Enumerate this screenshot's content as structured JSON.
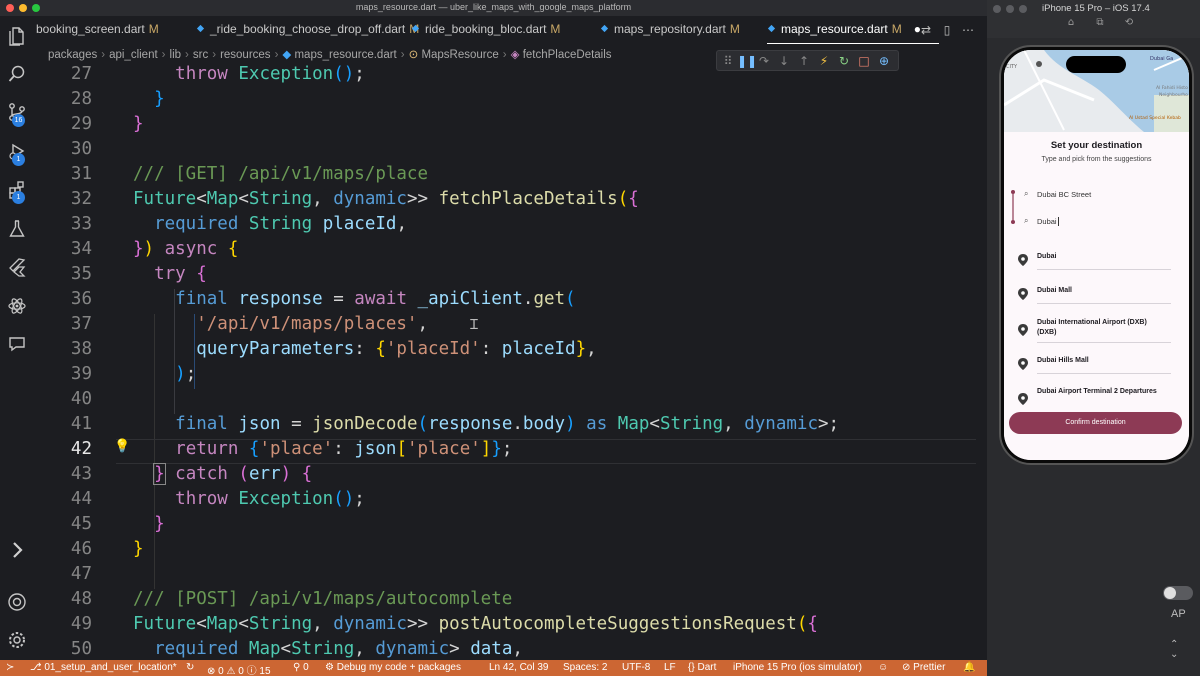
{
  "window": {
    "title": "maps_resource.dart — uber_like_maps_with_google_maps_platform"
  },
  "activity": {
    "badges": {
      "scm": "16",
      "run": "1",
      "extensions": "1"
    }
  },
  "tabs": [
    {
      "label": "booking_screen.dart",
      "status": "M"
    },
    {
      "label": "_ride_booking_choose_drop_off.dart",
      "status": "M"
    },
    {
      "label": "ride_booking_bloc.dart",
      "status": "M"
    },
    {
      "label": "maps_repository.dart",
      "status": "M"
    },
    {
      "label": "maps_resource.dart",
      "status": "M"
    }
  ],
  "breadcrumb": [
    "packages",
    "api_client",
    "lib",
    "src",
    "resources",
    "maps_resource.dart",
    "MapsResource",
    "fetchPlaceDetails"
  ],
  "editor": {
    "line_numbers": [
      "27",
      "28",
      "29",
      "30",
      "31",
      "32",
      "33",
      "34",
      "35",
      "36",
      "37",
      "38",
      "39",
      "40",
      "41",
      "42",
      "43",
      "44",
      "45",
      "46",
      "47",
      "48",
      "49",
      "50"
    ],
    "current_line": "42",
    "code": {
      "get_comment": "/// [GET] /api/v1/maps/place",
      "post_comment": "/// [POST] /api/v1/maps/autocomplete",
      "fn1_name": "fetchPlaceDetails",
      "fn2_name": "postAutocompleteSuggestionsRequest",
      "url": "'/api/v1/maps/places'",
      "qp_key": "'placeId'",
      "json_key": "'place'"
    }
  },
  "status_bar": {
    "branch": "01_setup_and_user_location*",
    "errors": "0",
    "warnings": "0",
    "infos": "15",
    "ports": "0",
    "debug": "Debug my code + packages",
    "cursor": "Ln 42, Col 39",
    "spaces": "Spaces: 2",
    "encoding": "UTF-8",
    "eol": "LF",
    "language": "Dart",
    "device": "iPhone 15 Pro (ios simulator)",
    "prettier": "Prettier"
  },
  "simulator": {
    "title": "iPhone 15 Pro – iOS 17.4",
    "side_label": "AP",
    "map_labels": [
      "CITY",
      "Dubai Ga",
      "Al Fahidi Histo",
      "Neighbourho",
      "Al Ustad Special Kebab"
    ],
    "sheet_title": "Set your destination",
    "sheet_subtitle": "Type and pick from the suggestions",
    "pickup_value": "Dubai BC Street",
    "destination_value": "Dubai",
    "suggestions": [
      "Dubai",
      "Dubai Mall",
      "Dubai International Airport (DXB) (DXB)",
      "Dubai Hills Mall",
      "Dubai Airport Terminal 2 Departures"
    ],
    "confirm_label": "Confirm destination"
  },
  "colors": {
    "status_bar": "#cc6633",
    "confirm_button": "#8d3a55",
    "badge": "#2b7fe0"
  }
}
